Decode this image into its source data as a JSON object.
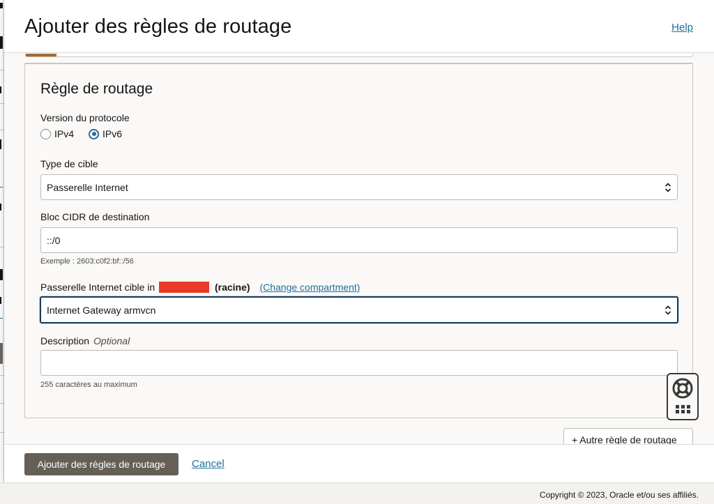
{
  "header": {
    "title": "Ajouter des règles de routage",
    "help_label": "Help"
  },
  "card": {
    "title": "Règle de routage",
    "protocol": {
      "label": "Version du protocole",
      "options": [
        "IPv4",
        "IPv6"
      ],
      "selected": "IPv6"
    },
    "target_type": {
      "label": "Type de cible",
      "value": "Passerelle Internet"
    },
    "destination_cidr": {
      "label": "Bloc CIDR de destination",
      "value": "::/0",
      "hint": "Exemple : 2603:c0f2:bf::/56"
    },
    "target_gateway": {
      "label": "Passerelle Internet cible in",
      "root_suffix": "(racine)",
      "change_link": "(Change compartment)",
      "value": "Internet Gateway armvcn"
    },
    "description": {
      "label": "Description",
      "optional_label": "Optional",
      "value": "",
      "hint": "255 caractères au maximum"
    }
  },
  "add_rule_label": "+ Autre règle de routage",
  "footer": {
    "submit_label": "Ajouter des règles de routage",
    "cancel_label": "Cancel"
  },
  "copyright": "Copyright © 2023, Oracle et/ou ses affiliés.",
  "colors": {
    "accent_link": "#1f6f9b",
    "primary_button": "#665f58",
    "radio_selected": "#2f6593",
    "redaction": "#e8392b"
  }
}
